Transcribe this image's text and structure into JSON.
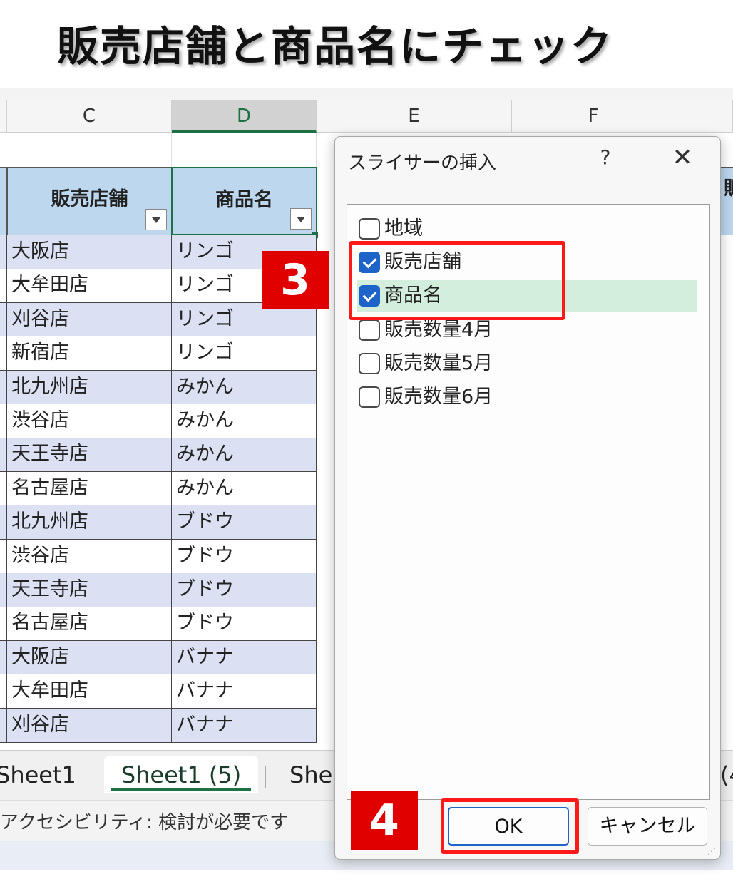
{
  "page_title": "販売店舗と商品名にチェック",
  "sheet": {
    "columns": [
      "C",
      "D",
      "E",
      "F"
    ],
    "selected_column": "D",
    "headers": {
      "store": "販売店舗",
      "product": "商品名",
      "partial_right": "販"
    },
    "rows": [
      {
        "store": "大阪店",
        "product": "リンゴ"
      },
      {
        "store": "大牟田店",
        "product": "リンゴ"
      },
      {
        "store": "刈谷店",
        "product": "リンゴ"
      },
      {
        "store": "新宿店",
        "product": "リンゴ"
      },
      {
        "store": "北九州店",
        "product": "みかん"
      },
      {
        "store": "渋谷店",
        "product": "みかん"
      },
      {
        "store": "天王寺店",
        "product": "みかん"
      },
      {
        "store": "名古屋店",
        "product": "みかん"
      },
      {
        "store": "北九州店",
        "product": "ブドウ"
      },
      {
        "store": "渋谷店",
        "product": "ブドウ"
      },
      {
        "store": "天王寺店",
        "product": "ブドウ"
      },
      {
        "store": "名古屋店",
        "product": "ブドウ"
      },
      {
        "store": "大阪店",
        "product": "バナナ"
      },
      {
        "store": "大牟田店",
        "product": "バナナ"
      },
      {
        "store": "刈谷店",
        "product": "バナナ"
      }
    ]
  },
  "tabs": [
    {
      "label": "Sheet1"
    },
    {
      "label": "Sheet1 (5)",
      "active": true
    },
    {
      "label": "She"
    },
    {
      "label": "(4"
    }
  ],
  "status": {
    "accessibility": "アクセシビリティ: 検討が必要です"
  },
  "dialog": {
    "title": "スライサーの挿入",
    "help_label": "?",
    "close_label": "✕",
    "fields": [
      {
        "label": "地域",
        "checked": false
      },
      {
        "label": "販売店舗",
        "checked": true
      },
      {
        "label": "商品名",
        "checked": true,
        "highlighted": true
      },
      {
        "label": "販売数量4月",
        "checked": false
      },
      {
        "label": "販売数量5月",
        "checked": false
      },
      {
        "label": "販売数量6月",
        "checked": false
      }
    ],
    "ok_label": "OK",
    "cancel_label": "キャンセル"
  },
  "annotations": {
    "step3": "3",
    "step4": "4"
  },
  "colors": {
    "accent_green": "#1e7145",
    "checkbox_blue": "#1e64c8",
    "annotation_red": "#e00000",
    "header_fill": "#bdd7ee",
    "band_fill": "#dbe0f3"
  }
}
